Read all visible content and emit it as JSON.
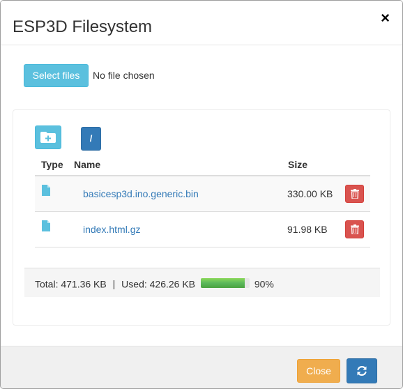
{
  "dialog": {
    "title": "ESP3D Filesystem",
    "close_glyph": "×"
  },
  "upload": {
    "select_label": "Select files",
    "status": "No file chosen"
  },
  "toolbar": {
    "create_folder_icon": "folder-plus-icon",
    "root_label": "/"
  },
  "table": {
    "headers": {
      "type": "Type",
      "name": "Name",
      "size": "Size"
    },
    "rows": [
      {
        "type_icon": "file-icon",
        "name": "basicesp3d.ino.generic.bin",
        "size": "330.00 KB",
        "action_icon": "trash-icon"
      },
      {
        "type_icon": "file-icon",
        "name": "index.html.gz",
        "size": "91.98 KB",
        "action_icon": "trash-icon"
      }
    ]
  },
  "usage": {
    "total_text": "Total: 471.36 KB",
    "separator": "|",
    "used_text": "Used: 426.26 KB",
    "percent_text": "90%",
    "percent": 90
  },
  "footer": {
    "close_label": "Close",
    "refresh_icon": "refresh-icon"
  },
  "colors": {
    "info": "#5bc0de",
    "primary": "#337ab7",
    "danger": "#d9534f",
    "warning": "#f0ad4e",
    "success": "#5cb85c"
  }
}
